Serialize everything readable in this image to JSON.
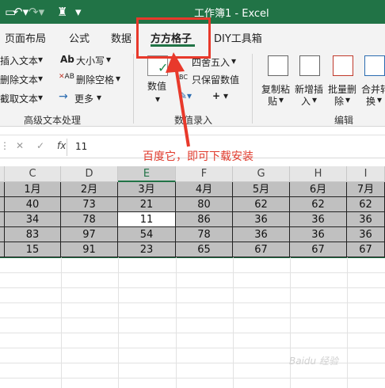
{
  "titlebar": {
    "title": "工作簿1 - Excel",
    "save_icon": "save-icon",
    "undo_icon": "undo-icon",
    "redo_icon": "redo-icon",
    "brush_icon": "format-painter-icon",
    "dropdown_icon": "chevron-down-icon"
  },
  "tabs": [
    "页面布局",
    "公式",
    "数据",
    "方方格子",
    "DIY工具箱"
  ],
  "active_tab": "方方格子",
  "ribbon": {
    "group1": {
      "items": [
        "插入文本",
        "删除文本",
        "截取文本"
      ],
      "label": "高级文本处理"
    },
    "group2": {
      "items": [
        "大小写",
        "删除空格",
        "更多"
      ]
    },
    "group3": {
      "numeric_label": "数值",
      "items": [
        "四舍五入",
        "只保留数值"
      ],
      "label": "数值录入",
      "plus": "+"
    },
    "group4": {
      "buttons": [
        {
          "line1": "复制粘",
          "line2": "贴"
        },
        {
          "line1": "新增插",
          "line2": "入"
        },
        {
          "line1": "批量删",
          "line2": "除"
        },
        {
          "line1": "合并转",
          "line2": "换"
        }
      ],
      "label": "编辑"
    }
  },
  "formula": {
    "fx": "fx",
    "value": "11"
  },
  "grid": {
    "columns": [
      "C",
      "D",
      "E",
      "F",
      "G",
      "H",
      "I"
    ],
    "rows": [
      [
        "1月",
        "2月",
        "3月",
        "4月",
        "5月",
        "6月",
        "7月"
      ],
      [
        "40",
        "73",
        "21",
        "80",
        "62",
        "62",
        "62"
      ],
      [
        "34",
        "78",
        "11",
        "86",
        "36",
        "36",
        "36"
      ],
      [
        "83",
        "97",
        "54",
        "78",
        "36",
        "36",
        "36"
      ],
      [
        "15",
        "91",
        "23",
        "65",
        "67",
        "67",
        "67"
      ]
    ]
  },
  "annotation": "百度它，即可下载安装",
  "watermark": "Baidu 经验"
}
